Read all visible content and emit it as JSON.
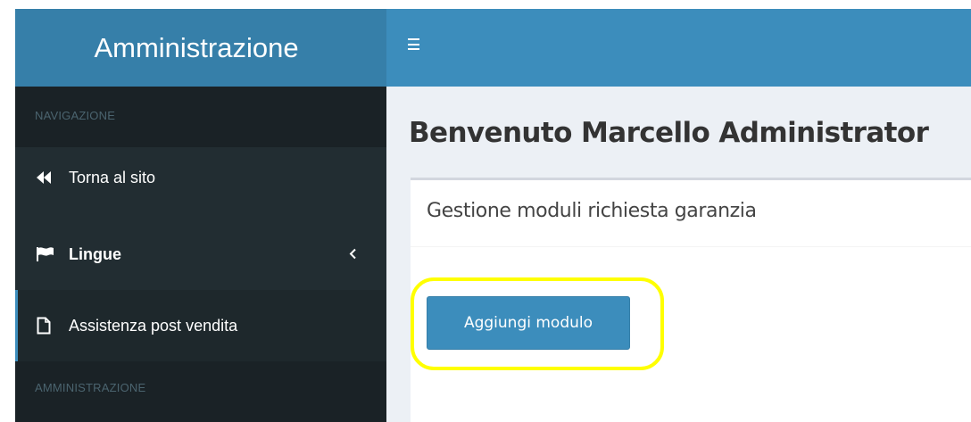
{
  "sidebar": {
    "logo": "Amministrazione",
    "section_navigation": "NAVIGAZIONE",
    "items": [
      {
        "label": "Torna al sito",
        "icon": "fast-backward-icon"
      },
      {
        "label": "Lingue",
        "icon": "flag-icon"
      },
      {
        "label": "Assistenza post vendita",
        "icon": "file-icon"
      }
    ],
    "section_admin": "AMMINISTRAZIONE"
  },
  "navbar": {
    "toggle_icon": "hamburger-icon"
  },
  "main": {
    "title": "Benvenuto Marcello Administrator",
    "box_title": "Gestione moduli richiesta garanzia",
    "add_button": "Aggiungi modulo"
  },
  "colors": {
    "sidebar_bg": "#222d32",
    "logo_bg": "#367fa9",
    "navbar_bg": "#3c8dbc",
    "highlight": "#ffff00"
  }
}
